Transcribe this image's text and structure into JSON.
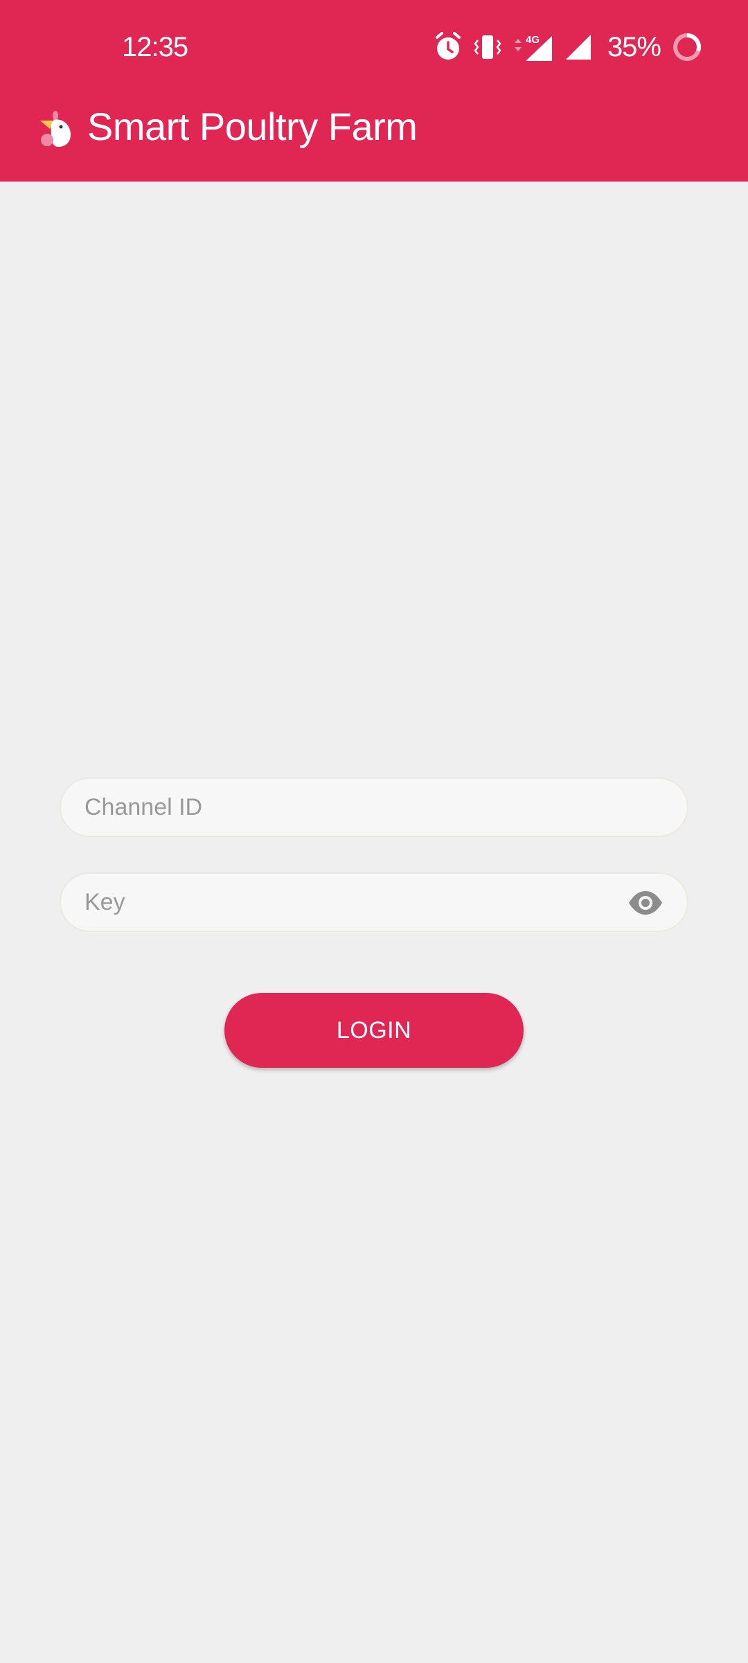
{
  "status_bar": {
    "time": "12:35",
    "network": "4G",
    "battery": "35%",
    "icons": [
      "alarm-icon",
      "vibrate-icon",
      "network-4g-icon",
      "signal-icon",
      "signal-icon-2",
      "battery-ring-icon"
    ],
    "battery_level": 0.35
  },
  "app_bar": {
    "title": "Smart Poultry Farm",
    "logo": "chicken-logo-icon"
  },
  "login_form": {
    "channel_id": {
      "placeholder": "Channel ID",
      "value": ""
    },
    "key": {
      "placeholder": "Key",
      "value": "",
      "toggle_icon": "eye-icon"
    },
    "login_label": "LOGIN"
  },
  "colors": {
    "primary": "#e02754",
    "background": "#efefef",
    "field_background": "#f7f7f7",
    "placeholder": "#999999"
  }
}
